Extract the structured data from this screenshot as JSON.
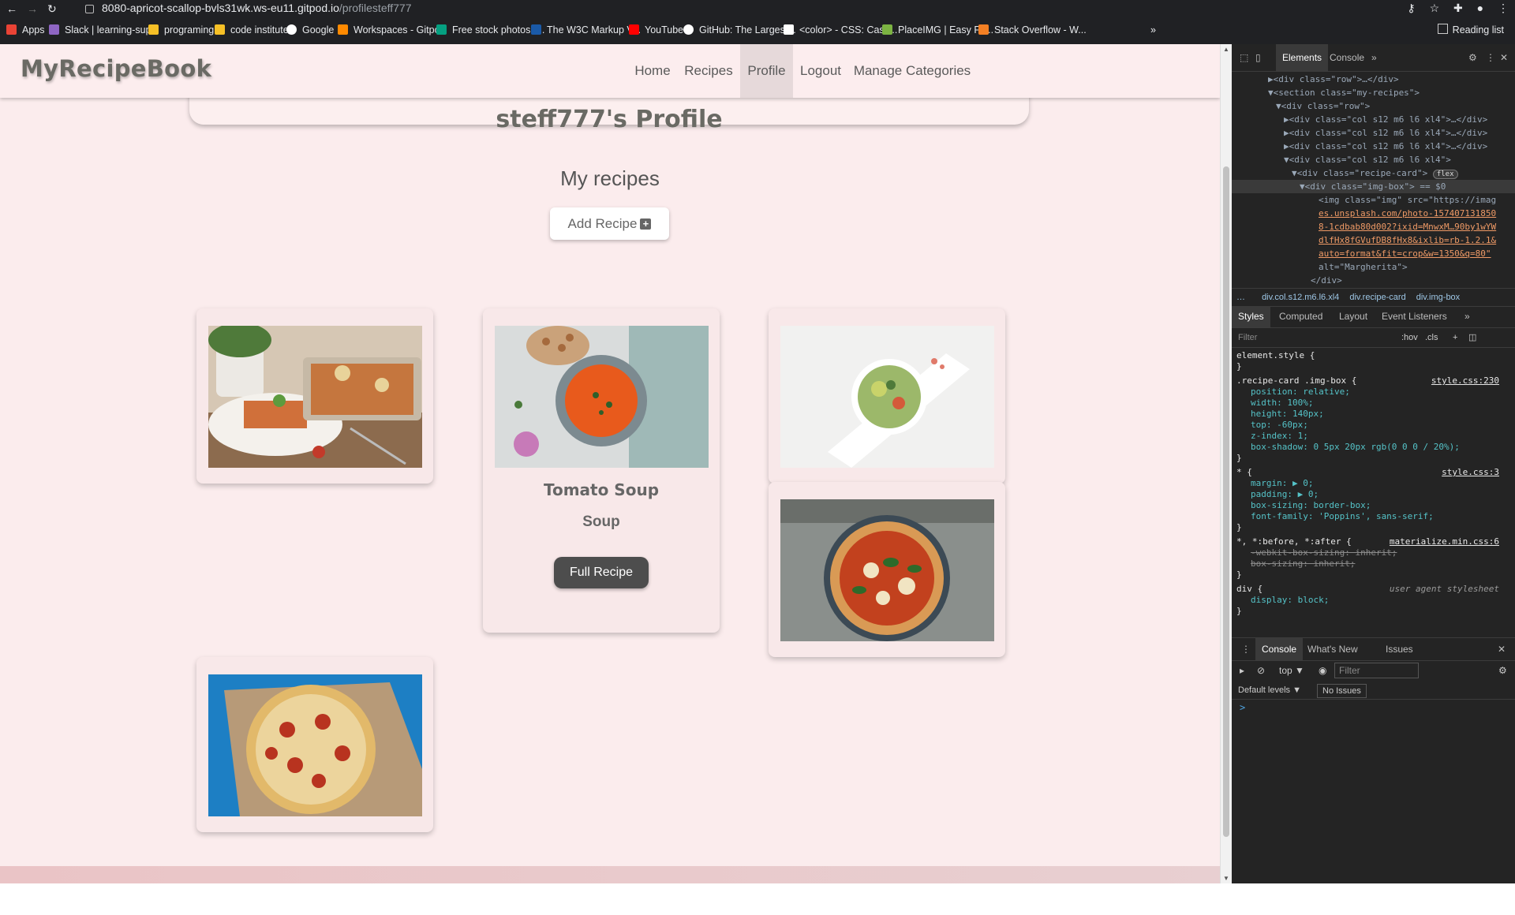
{
  "browser": {
    "url_host": "8080-apricot-scallop-bvls31wk.ws-eu11.gitpod.io",
    "url_path": "/profilesteff777",
    "reading_list": "Reading list",
    "bookmarks": [
      {
        "label": "Apps",
        "color": "#ea4335"
      },
      {
        "label": "Slack | learning-sup...",
        "color": "#8f66c4"
      },
      {
        "label": "programing",
        "color": "#f6c026"
      },
      {
        "label": "code institute",
        "color": "#f6c026"
      },
      {
        "label": "Google",
        "color": "#ffffff"
      },
      {
        "label": "Workspaces - Gitpod",
        "color": "#ff8a00"
      },
      {
        "label": "Free stock photos -...",
        "color": "#05a081"
      },
      {
        "label": "The W3C Markup V...",
        "color": "#1a5aa8"
      },
      {
        "label": "YouTube",
        "color": "#ff0000"
      },
      {
        "label": "GitHub: The Largest...",
        "color": "#ffffff"
      },
      {
        "label": "<color> - CSS: Casc...",
        "color": "#ffffff"
      },
      {
        "label": "PlaceIMG | Easy FP...",
        "color": "#7cb342"
      },
      {
        "label": "Stack Overflow - W...",
        "color": "#f48024"
      }
    ]
  },
  "site": {
    "logo": "MyRecipeBook",
    "nav": [
      "Home",
      "Recipes",
      "Profile",
      "Logout",
      "Manage Categories"
    ],
    "active_nav": "Profile",
    "profile_title": "steff777's Profile",
    "section_title": "My recipes",
    "add_recipe": "Add Recipe",
    "add_icon": "+",
    "recipes": [
      {
        "image": "lasagna"
      },
      {
        "image": "tomato-soup",
        "title": "Tomato Soup",
        "category": "Soup",
        "button": "Full Recipe"
      },
      {
        "image": "salad"
      },
      {
        "image": "margherita-pizza"
      },
      {
        "image": "pepperoni-pizza"
      }
    ]
  },
  "devtools": {
    "tabs": [
      "Elements",
      "Console"
    ],
    "dom": [
      {
        "text": "▶<div class=\"row\">…</div>"
      },
      {
        "text": "▼<section class=\"my-recipes\">"
      },
      {
        "text": "▼<div class=\"row\">"
      },
      {
        "text": "▶<div class=\"col s12 m6 l6 xl4\">…</div>"
      },
      {
        "text": "▶<div class=\"col s12 m6 l6 xl4\">…</div>"
      },
      {
        "text": "▶<div class=\"col s12 m6 l6 xl4\">…</div>"
      },
      {
        "text": "▼<div class=\"col s12 m6 l6 xl4\">"
      },
      {
        "text": "▼<div class=\"recipe-card\">"
      },
      {
        "text": "▼<div class=\"img-box\"> == $0"
      },
      {
        "text": "<img class=\"img\" src=\"https://imag"
      },
      {
        "text": "es.unsplash.com/photo-157407131850"
      },
      {
        "text": "8-1cdbab80d002?ixid=MnwxM…90by1wYW"
      },
      {
        "text": "dlfHx8fGVufDB8fHx8&ixlib=rb-1.2.1&"
      },
      {
        "text": "auto=format&fit=crop&w=1350&q=80\""
      },
      {
        "text": "alt=\"Margherita\">"
      },
      {
        "text": "</div>"
      }
    ],
    "flex_badge": "flex",
    "breadcrumbs": [
      "…",
      "div.col.s12.m6.l6.xl4",
      "div.recipe-card",
      "div.img-box"
    ],
    "style_tabs": [
      "Styles",
      "Computed",
      "Layout",
      "Event Listeners"
    ],
    "filter_placeholder": "Filter",
    "hov": ":hov",
    "cls": ".cls",
    "rules": [
      {
        "selector": "element.style {",
        "source": "",
        "props": []
      },
      {
        "selector": ".recipe-card .img-box {",
        "source": "style.css:230",
        "props": [
          "position: relative;",
          "width: 100%;",
          "height: 140px;",
          "top: -60px;",
          "z-index: 1;",
          "box-shadow: 0 5px 20px rgb(0 0 0 / 20%);"
        ]
      },
      {
        "selector": "* {",
        "source": "style.css:3",
        "props": [
          "margin: ▶ 0;",
          "padding: ▶ 0;",
          "box-sizing: border-box;",
          "font-family: 'Poppins', sans-serif;"
        ]
      },
      {
        "selector": "*, *:before, *:after {",
        "source": "materialize.min.css:6",
        "props": [
          "-webkit-box-sizing: inherit;",
          "box-sizing: inherit;"
        ]
      },
      {
        "selector": "div {",
        "source": "user agent stylesheet",
        "props": [
          "display: block;"
        ]
      }
    ],
    "drawer_tabs": [
      "Console",
      "What's New",
      "Issues"
    ],
    "context": "top ▼",
    "default_levels": "Default levels ▼",
    "no_issues": "No Issues",
    "prompt": ">"
  }
}
